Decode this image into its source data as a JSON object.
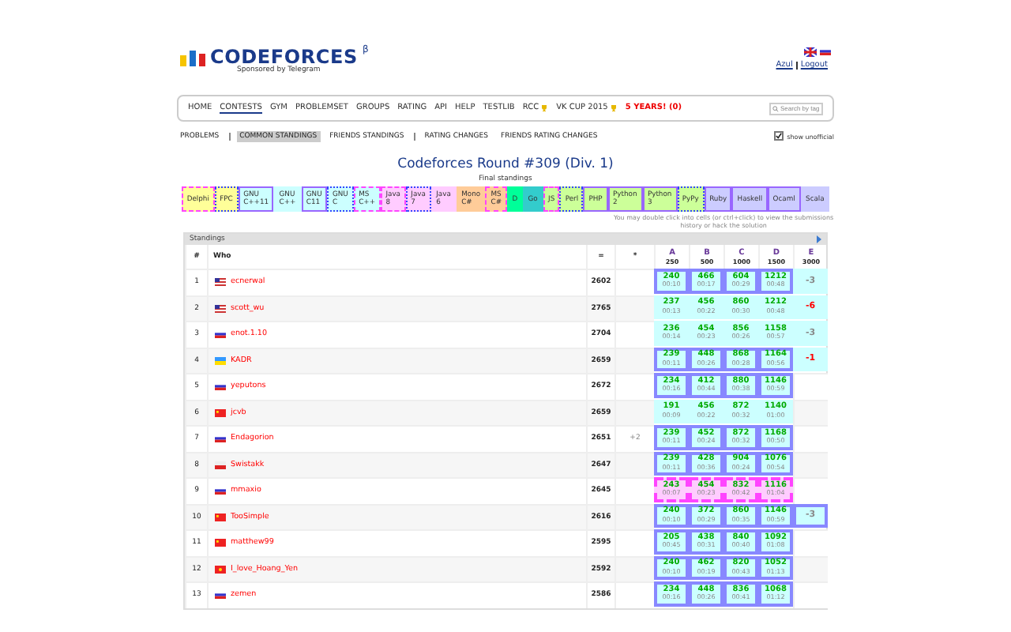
{
  "header": {
    "logo": "CODEFORCES",
    "beta": "β",
    "sponsor": "Sponsored by Telegram",
    "user_links": [
      "Azul",
      "Logout"
    ]
  },
  "menu": [
    {
      "label": "HOME",
      "selected": false,
      "kind": "link"
    },
    {
      "label": "CONTESTS",
      "selected": true,
      "kind": "link"
    },
    {
      "label": "GYM",
      "selected": false,
      "kind": "link"
    },
    {
      "label": "PROBLEMSET",
      "selected": false,
      "kind": "link"
    },
    {
      "label": "GROUPS",
      "selected": false,
      "kind": "link"
    },
    {
      "label": "RATING",
      "selected": false,
      "kind": "link"
    },
    {
      "label": "API",
      "selected": false,
      "kind": "link"
    },
    {
      "label": "HELP",
      "selected": false,
      "kind": "link"
    },
    {
      "label": "TESTLIB",
      "selected": false,
      "kind": "link"
    },
    {
      "label": "RCC",
      "selected": false,
      "kind": "trophy"
    },
    {
      "label": "VK CUP 2015",
      "selected": false,
      "kind": "trophy"
    },
    {
      "label": "5 YEARS! (0)",
      "selected": false,
      "kind": "accent"
    }
  ],
  "search": {
    "placeholder": "Search by tag"
  },
  "submenu": [
    {
      "label": "PROBLEMS",
      "selected": false,
      "divider": true
    },
    {
      "label": "COMMON STANDINGS",
      "selected": true,
      "divider": false
    },
    {
      "label": "FRIENDS STANDINGS",
      "selected": false,
      "divider": true
    },
    {
      "label": "RATING CHANGES",
      "selected": false,
      "divider": false
    },
    {
      "label": "FRIENDS RATING CHANGES",
      "selected": false,
      "divider": false
    }
  ],
  "show_unofficial": {
    "label": "show unofficial",
    "checked": true
  },
  "title": "Codeforces Round #309 (Div. 1)",
  "subtitle": "Final standings",
  "languages": [
    {
      "label": "Delphi",
      "color": "#ffff99",
      "kind": "dashed"
    },
    {
      "label": "FPC",
      "color": "#ffff99",
      "kind": "dotted"
    },
    {
      "label": "GNU\nC++11",
      "color": "#ccffff",
      "kind": "solid"
    },
    {
      "label": "GNU\nC++",
      "color": "#ccffff",
      "kind": "plain"
    },
    {
      "label": "GNU\nC11",
      "color": "#ccffff",
      "kind": "solid"
    },
    {
      "label": "GNU\nC",
      "color": "#ccffff",
      "kind": "dotted"
    },
    {
      "label": "MS\nC++",
      "color": "#ccffff",
      "kind": "dashed"
    },
    {
      "label": "Java\n8",
      "color": "#ffccff",
      "kind": "dashed"
    },
    {
      "label": "Java\n7",
      "color": "#ffccff",
      "kind": "dotted"
    },
    {
      "label": "Java\n6",
      "color": "#ffccff",
      "kind": "plain"
    },
    {
      "label": "Mono\nC#",
      "color": "#ffcc99",
      "kind": "plain"
    },
    {
      "label": "MS\nC#",
      "color": "#ffcc99",
      "kind": "dashed"
    },
    {
      "label": "D",
      "color": "#00ff99",
      "kind": "plain"
    },
    {
      "label": "Go",
      "color": "#33cccc",
      "kind": "plain"
    },
    {
      "label": "JS",
      "color": "#ccff99",
      "kind": "dashed"
    },
    {
      "label": "Perl",
      "color": "#ccff99",
      "kind": "dotted"
    },
    {
      "label": "PHP",
      "color": "#ccff99",
      "kind": "solid"
    },
    {
      "label": "Python\n2",
      "color": "#ccff99",
      "kind": "solid"
    },
    {
      "label": "Python\n3",
      "color": "#ccff99",
      "kind": "solid"
    },
    {
      "label": "PyPy",
      "color": "#ccff99",
      "kind": "dotted"
    },
    {
      "label": "Ruby",
      "color": "#ccccff",
      "kind": "solid"
    },
    {
      "label": "Haskell",
      "color": "#ccccff",
      "kind": "solid"
    },
    {
      "label": "Ocaml",
      "color": "#ccccff",
      "kind": "solid"
    },
    {
      "label": "Scala",
      "color": "#ccccff",
      "kind": "plain"
    }
  ],
  "note": "You may double click into cells (or ctrl+click) to view the submissions history or hack the solution",
  "standings": {
    "title": "Standings",
    "columns": [
      {
        "label": "#",
        "kind": "plain"
      },
      {
        "label": "Who",
        "kind": "plain"
      },
      {
        "label": "=",
        "kind": "plain"
      },
      {
        "label": "*",
        "kind": "plain"
      },
      {
        "label": "A",
        "points": "250",
        "kind": "problem"
      },
      {
        "label": "B",
        "points": "500",
        "kind": "problem"
      },
      {
        "label": "C",
        "points": "1000",
        "kind": "problem"
      },
      {
        "label": "D",
        "points": "1500",
        "kind": "problem"
      },
      {
        "label": "E",
        "points": "3000",
        "kind": "problem"
      }
    ],
    "rows": [
      {
        "rank": "1",
        "flag": {
          "kind": "us"
        },
        "handle": "ecnerwal",
        "score": "2602",
        "kind": "cpp11",
        "cells": [
          [
            "240",
            "00:10"
          ],
          [
            "466",
            "00:17"
          ],
          [
            "604",
            "00:29"
          ],
          [
            "1212",
            "00:48"
          ]
        ],
        "extra": {
          "text": "-3",
          "color": "#888888"
        }
      },
      {
        "rank": "2",
        "flag": {
          "kind": "us"
        },
        "handle": "scott_wu",
        "score": "2765",
        "kind": "cpp",
        "cells": [
          [
            "237",
            "00:13"
          ],
          [
            "456",
            "00:22"
          ],
          [
            "860",
            "00:30"
          ],
          [
            "1212",
            "00:48"
          ]
        ],
        "extra": {
          "text": "-6",
          "color": "#ff0000"
        }
      },
      {
        "rank": "3",
        "flag": {
          "kind": "ru"
        },
        "handle": "enot.1.10",
        "score": "2704",
        "kind": "cpp",
        "cells": [
          [
            "236",
            "00:14"
          ],
          [
            "454",
            "00:23"
          ],
          [
            "856",
            "00:26"
          ],
          [
            "1158",
            "00:57"
          ]
        ],
        "extra": {
          "text": "-3",
          "color": "#888888"
        }
      },
      {
        "rank": "4",
        "flag": {
          "kind": "ua"
        },
        "handle": "KADR",
        "score": "2659",
        "kind": "cpp11",
        "cells": [
          [
            "239",
            "00:11"
          ],
          [
            "448",
            "00:26"
          ],
          [
            "868",
            "00:28"
          ],
          [
            "1164",
            "00:56"
          ]
        ],
        "extra": {
          "text": "-1",
          "color": "#ff0000"
        }
      },
      {
        "rank": "5",
        "flag": {
          "kind": "ru"
        },
        "handle": "yeputons",
        "score": "2672",
        "kind": "cpp11",
        "cells": [
          [
            "234",
            "00:16"
          ],
          [
            "412",
            "00:44"
          ],
          [
            "880",
            "00:38"
          ],
          [
            "1146",
            "00:59"
          ]
        ]
      },
      {
        "rank": "6",
        "flag": {
          "kind": "cn"
        },
        "handle": "jcvb",
        "score": "2659",
        "kind": "cpp",
        "cells": [
          [
            "191",
            "00:09"
          ],
          [
            "456",
            "00:22"
          ],
          [
            "872",
            "00:32"
          ],
          [
            "1140",
            "01:00"
          ]
        ]
      },
      {
        "rank": "7",
        "flag": {
          "kind": "ru"
        },
        "handle": "Endagorion",
        "score": "2651",
        "hacks": "+2",
        "kind": "cpp11",
        "cells": [
          [
            "239",
            "00:11"
          ],
          [
            "452",
            "00:24"
          ],
          [
            "872",
            "00:32"
          ],
          [
            "1168",
            "00:50"
          ]
        ]
      },
      {
        "rank": "8",
        "flag": {
          "kind": "pl"
        },
        "handle": "Swistakk",
        "score": "2647",
        "kind": "cpp11",
        "cells": [
          [
            "239",
            "00:11"
          ],
          [
            "428",
            "00:36"
          ],
          [
            "904",
            "00:24"
          ],
          [
            "1076",
            "00:54"
          ]
        ]
      },
      {
        "rank": "9",
        "flag": {
          "kind": "ru"
        },
        "handle": "mmaxio",
        "score": "2645",
        "kind": "java8",
        "cells": [
          [
            "243",
            "00:07"
          ],
          [
            "454",
            "00:23"
          ],
          [
            "832",
            "00:42"
          ],
          [
            "1116",
            "01:04"
          ]
        ]
      },
      {
        "rank": "10",
        "flag": {
          "kind": "cn"
        },
        "handle": "TooSimple",
        "score": "2616",
        "kind": "cpp11",
        "cells": [
          [
            "240",
            "00:10"
          ],
          [
            "372",
            "00:29"
          ],
          [
            "860",
            "00:35"
          ],
          [
            "1146",
            "00:59"
          ]
        ],
        "extra": {
          "text": "-3",
          "color": "#888888"
        }
      },
      {
        "rank": "11",
        "flag": {
          "kind": "cn"
        },
        "handle": "matthew99",
        "score": "2595",
        "kind": "cpp11",
        "cells": [
          [
            "205",
            "00:45"
          ],
          [
            "438",
            "00:31"
          ],
          [
            "840",
            "00:40"
          ],
          [
            "1092",
            "01:08"
          ]
        ]
      },
      {
        "rank": "12",
        "flag": {
          "kind": "vn"
        },
        "handle": "I_love_Hoang_Yen",
        "score": "2592",
        "kind": "cpp11",
        "cells": [
          [
            "240",
            "00:10"
          ],
          [
            "462",
            "00:19"
          ],
          [
            "820",
            "00:43"
          ],
          [
            "1052",
            "01:13"
          ]
        ]
      },
      {
        "rank": "13",
        "flag": {
          "kind": "ru"
        },
        "handle": "zemen",
        "score": "2586",
        "kind": "cpp11",
        "cells": [
          [
            "234",
            "00:16"
          ],
          [
            "448",
            "00:26"
          ],
          [
            "836",
            "00:41"
          ],
          [
            "1068",
            "01:12"
          ]
        ]
      }
    ]
  }
}
